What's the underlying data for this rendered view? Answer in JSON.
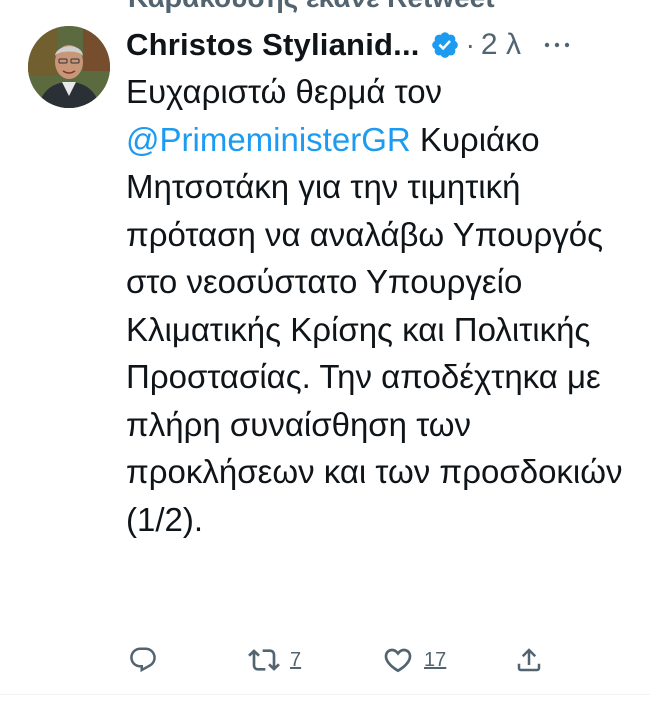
{
  "retweet_context": "Καρακούσης έκανε Retweet",
  "tweet": {
    "author_name": "Christos Stylianid...",
    "separator": "·",
    "time": "2 λ",
    "text_part1": "Ευχαριστώ θερμά τον ",
    "mention": "@PrimeministerGR",
    "text_part2": " Κυριάκο Μητσοτάκη για την τιμητική πρόταση να αναλάβω Υπουργός στο νεοσύστατο Υπουργείο Κλιματικής Κρίσης και Πολιτικής Προστασίας. Την αποδέχτηκα με πλήρη συναίσθηση των προκλήσεων και των προσδοκιών (1/2).",
    "icons": {
      "verified": "verified-badge-icon",
      "more": "more-options-icon"
    }
  },
  "actions": {
    "reply": {
      "icon": "reply-icon"
    },
    "retweet": {
      "icon": "retweet-icon",
      "count": "7"
    },
    "like": {
      "icon": "like-icon",
      "count": "17"
    },
    "share": {
      "icon": "share-icon"
    }
  },
  "colors": {
    "mention": "#1d9bf0",
    "verified": "#1d9bf0",
    "secondary_text": "#536471",
    "primary_text": "#0f1419"
  }
}
